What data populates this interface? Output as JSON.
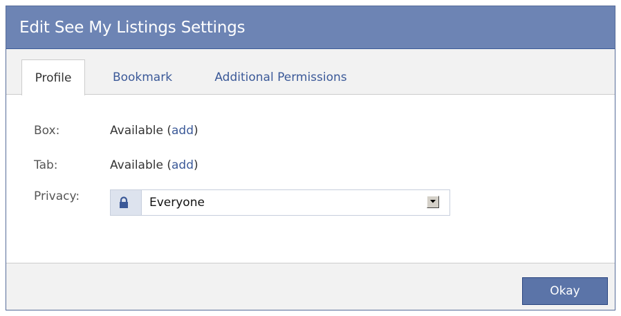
{
  "dialog": {
    "title": "Edit See My Listings Settings"
  },
  "tabs": [
    {
      "label": "Profile",
      "active": true
    },
    {
      "label": "Bookmark",
      "active": false
    },
    {
      "label": "Additional Permissions",
      "active": false
    }
  ],
  "profile": {
    "box": {
      "label": "Box:",
      "status": "Available (",
      "link": "add",
      "suffix": ")"
    },
    "tab": {
      "label": "Tab:",
      "status": "Available (",
      "link": "add",
      "suffix": ")"
    },
    "privacy": {
      "label": "Privacy:",
      "icon": "lock-icon",
      "selected": "Everyone"
    }
  },
  "footer": {
    "okay_label": "Okay"
  },
  "colors": {
    "header": "#6d84b4",
    "link": "#3b5998",
    "button": "#5b74a8"
  }
}
